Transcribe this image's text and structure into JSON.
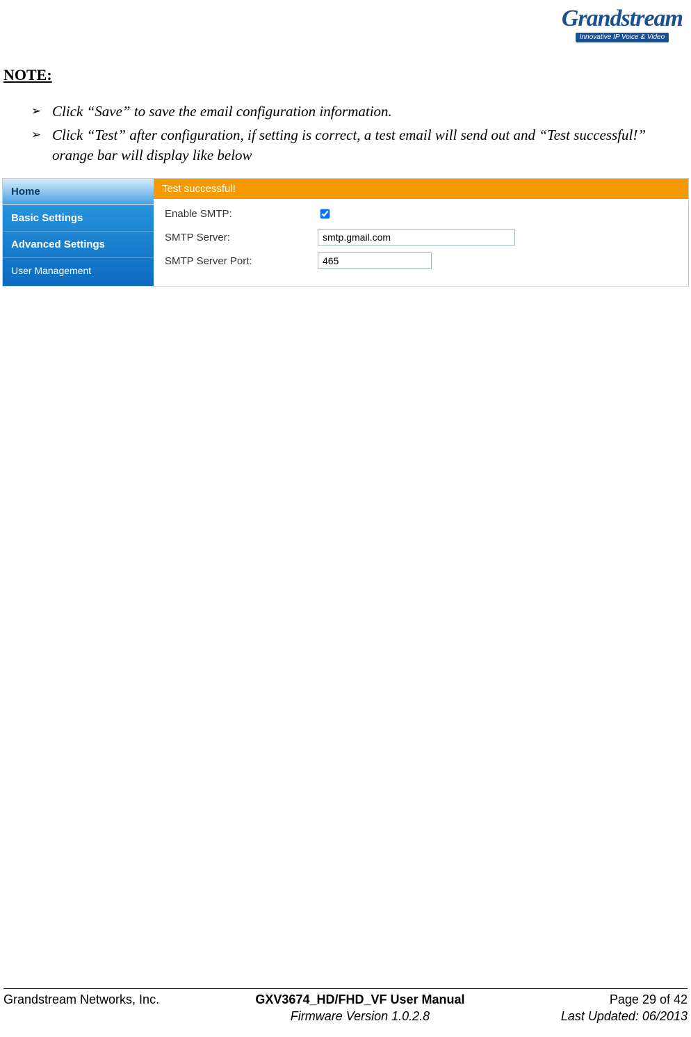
{
  "logo": {
    "company": "Grandstream",
    "tagline": "Innovative IP Voice & Video"
  },
  "note_heading": "NOTE:",
  "bullets": [
    "Click “Save” to save the email configuration information.",
    "Click “Test” after configuration, if setting is correct, a test email will send out and “Test successful!” orange bar will display like below"
  ],
  "ui": {
    "sidebar": {
      "items": [
        {
          "label": "Home",
          "selected": true,
          "bold": true
        },
        {
          "label": "Basic Settings",
          "selected": false,
          "bold": true
        },
        {
          "label": "Advanced Settings",
          "selected": false,
          "bold": true
        },
        {
          "label": "User Management",
          "selected": false,
          "bold": false
        }
      ]
    },
    "success_message": "Test successful!",
    "form": {
      "enable_smtp_label": "Enable SMTP:",
      "enable_smtp_value": true,
      "smtp_server_label": "SMTP Server:",
      "smtp_server_value": "smtp.gmail.com",
      "smtp_port_label": "SMTP Server Port:",
      "smtp_port_value": "465"
    }
  },
  "footer": {
    "company": "Grandstream Networks, Inc.",
    "manual_title": "GXV3674_HD/FHD_VF User Manual",
    "firmware": "Firmware Version 1.0.2.8",
    "page_info": "Page 29 of 42",
    "last_updated": "Last Updated: 06/2013"
  }
}
